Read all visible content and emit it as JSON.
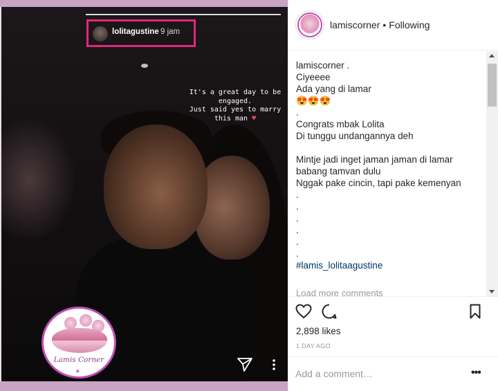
{
  "story": {
    "username": "lolitagustine",
    "time": "9 jam",
    "caption_lines": [
      "It's a great day to be",
      "engaged.",
      "Just said yes to marry",
      "this man"
    ],
    "caption_emoji": "♥",
    "logo_name": "Lamis Corner"
  },
  "post": {
    "account": "lamiscorner",
    "separator": "•",
    "follow_status": "Following",
    "caption": "lamiscorner .\nCiyeeee\nAda yang di lamar\n😍😍😍\n.\nCongrats mbak Lolita\nDi tunggu undangannya deh\n\nMintje jadi inget jaman jaman di lamar\nbabang tamvan dulu\nNggak pake cincin, tapi pake kemenyan\n.\n.\n.\n.\n.\n.",
    "hashtag": "#lamis_lolitaagustine",
    "load_more": "Load more comments",
    "likes": "2,898 likes",
    "date": "1 DAY AGO",
    "comment_placeholder": "Add a comment…",
    "more": "•••"
  },
  "icons": {
    "like": "heart-icon",
    "comment": "comment-icon",
    "save": "bookmark-icon",
    "share": "send-icon",
    "options": "more-vertical-icon"
  },
  "colors": {
    "highlight_box": "#e0287a",
    "brand_band": "#c9a3c4",
    "hashtag": "#003569"
  }
}
